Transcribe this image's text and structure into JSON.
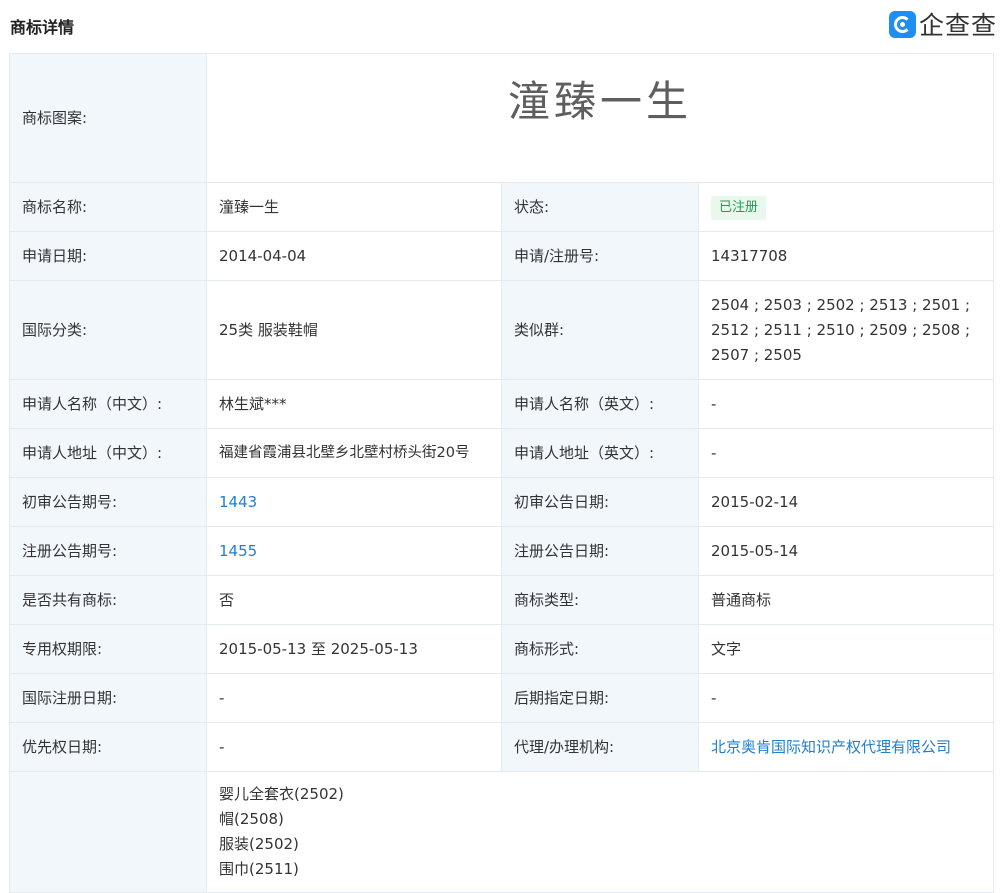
{
  "header": {
    "title": "商标详情",
    "logo_text": "企查查"
  },
  "trademark_image": {
    "label": "商标图案:",
    "text": "潼臻一生"
  },
  "rows": [
    {
      "label1": "商标名称:",
      "value1": "潼臻一生",
      "label2": "状态:",
      "value2": "已注册"
    },
    {
      "label1": "申请日期:",
      "value1": "2014-04-04",
      "label2": "申请/注册号:",
      "value2": "14317708"
    },
    {
      "label1": "国际分类:",
      "value1": "25类 服装鞋帽",
      "label2": "类似群:",
      "value2": "2504 ; 2503 ; 2502 ; 2513 ; 2501 ; 2512 ; 2511 ; 2510 ; 2509 ; 2508 ; 2507 ; 2505"
    },
    {
      "label1": "申请人名称（中文）:",
      "value1": "林生斌***",
      "label2": "申请人名称（英文）:",
      "value2": "-"
    },
    {
      "label1": "申请人地址（中文）:",
      "value1": "福建省霞浦县北壁乡北壁村桥头街20号",
      "label2": "申请人地址（英文）:",
      "value2": "-"
    },
    {
      "label1": "初审公告期号:",
      "value1": "1443",
      "label2": "初审公告日期:",
      "value2": "2015-02-14"
    },
    {
      "label1": "注册公告期号:",
      "value1": "1455",
      "label2": "注册公告日期:",
      "value2": "2015-05-14"
    },
    {
      "label1": "是否共有商标:",
      "value1": "否",
      "label2": "商标类型:",
      "value2": "普通商标"
    },
    {
      "label1": "专用权期限:",
      "value1": "2015-05-13 至 2025-05-13",
      "label2": "商标形式:",
      "value2": "文字"
    },
    {
      "label1": "国际注册日期:",
      "value1": "-",
      "label2": "后期指定日期:",
      "value2": "-"
    },
    {
      "label1": "优先权日期:",
      "value1": "-",
      "label2": "代理/办理机构:",
      "value2": "北京奥肯国际知识产权代理有限公司"
    }
  ],
  "goods": {
    "items": [
      "婴儿全套衣(2502)",
      "帽(2508)",
      "服装(2502)",
      "围巾(2511)"
    ]
  },
  "colors": {
    "label_bg": "#f2f7fc",
    "border": "#e4eaf2",
    "link": "#1f7fd1",
    "status_green": "#1e9e53"
  }
}
